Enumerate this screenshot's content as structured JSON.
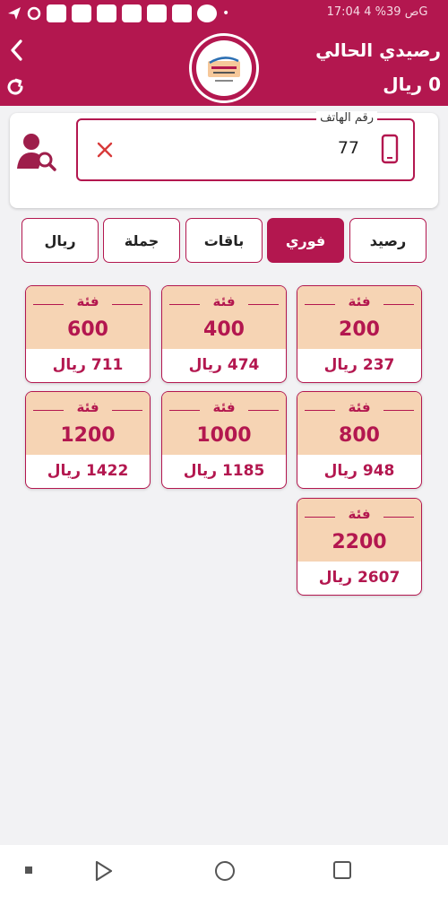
{
  "status_bar": {
    "text": "17:04 ص 39% 4G"
  },
  "header": {
    "balance_title": "رصيدي الحالي",
    "balance_value": "0 ريال",
    "background": "#b3174f"
  },
  "phone": {
    "label": "رقم الهاتف",
    "value": "77"
  },
  "tabs": [
    {
      "label": "رصيد",
      "active": false
    },
    {
      "label": "فوري",
      "active": true
    },
    {
      "label": "باقات",
      "active": false
    },
    {
      "label": "جملة",
      "active": false
    },
    {
      "label": "ريال",
      "active": false
    }
  ],
  "cards": [
    {
      "category": "فئة",
      "amount": "200",
      "price": "237 ريال"
    },
    {
      "category": "فئة",
      "amount": "400",
      "price": "474 ريال"
    },
    {
      "category": "فئة",
      "amount": "600",
      "price": "711 ريال"
    },
    {
      "category": "فئة",
      "amount": "800",
      "price": "948 ريال"
    },
    {
      "category": "فئة",
      "amount": "1000",
      "price": "1185 ريال"
    },
    {
      "category": "فئة",
      "amount": "1200",
      "price": "1422 ريال"
    },
    {
      "category": "فئة",
      "amount": "2200",
      "price": "2607 ريال"
    }
  ],
  "colors": {
    "accent": "#b3174f",
    "card_top": "#f6d4b4",
    "background": "#f2f2f4"
  }
}
